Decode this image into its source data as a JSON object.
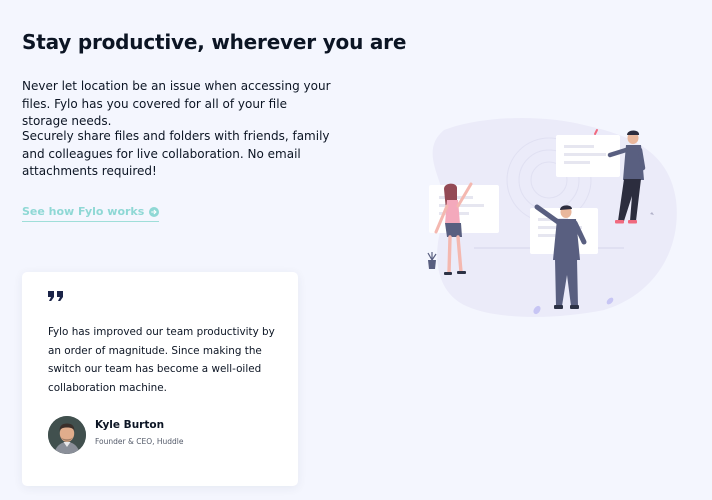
{
  "section": {
    "heading": "Stay productive, wherever you are",
    "paragraph_1": "Never let location be an issue when accessing your files. Fylo has you covered for all of your file storage needs.",
    "paragraph_2": "Securely share files and folders with friends, family and colleagues for live collaboration. No email attachments required!",
    "cta_label": "See how Fylo works"
  },
  "testimonial": {
    "quote": "Fylo has improved our team productivity by an order of magnitude. Since making the switch our team has become a well-oiled collaboration machine.",
    "author_name": "Kyle Burton",
    "author_role": "Founder & CEO, Huddle"
  },
  "colors": {
    "background": "#f4f6fe",
    "heading_text": "#0c1524",
    "link_accent": "#8fd8d5",
    "card_background": "#ffffff",
    "illustration_blob": "#ebebf9",
    "illustration_figure": "#595f80",
    "illustration_pink": "#f4a9bc"
  },
  "icons": {
    "quote": "quote-icon",
    "cta": "arrow-right-circle-icon",
    "illustration": "collaboration-illustration"
  }
}
